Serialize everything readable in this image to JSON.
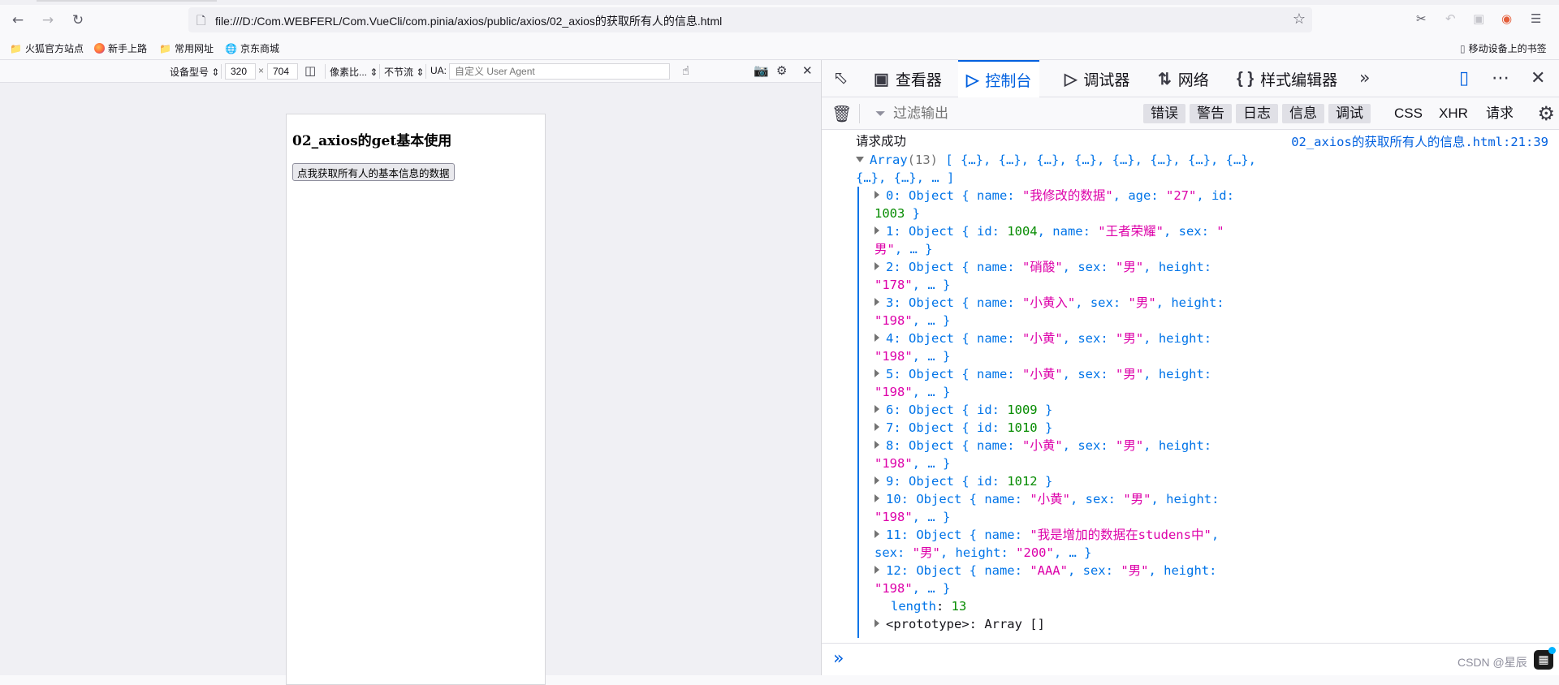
{
  "browser": {
    "url": "file:///D:/Com.WEBFERL/Com.VueCli/com.pinia/axios/public/axios/02_axios的获取所有人的信息.html"
  },
  "bookmarks": {
    "items": [
      "火狐官方站点",
      "新手上路",
      "常用网址",
      "京东商城"
    ],
    "mobile": "移动设备上的书签"
  },
  "rdm": {
    "device_type": "设备型号",
    "width": "320",
    "times": "×",
    "height": "704",
    "dpr": "像素比...",
    "throttle": "不节流",
    "ua_label": "UA:",
    "ua_placeholder": "自定义 User Agent"
  },
  "page": {
    "heading": "02_axios的get基本使用",
    "button": "点我获取所有人的基本信息的数据"
  },
  "devtools": {
    "tabs": [
      "查看器",
      "控制台",
      "调试器",
      "网络",
      "样式编辑器"
    ],
    "selected_tab": "控制台",
    "filter_placeholder": "过滤输出",
    "levels": [
      "错误",
      "警告",
      "日志",
      "信息",
      "调试"
    ],
    "extra_filters": [
      "CSS",
      "XHR",
      "请求"
    ]
  },
  "console": {
    "message": "请求成功",
    "source": "02_axios的获取所有人的信息.html:21:39",
    "array_label": "Array",
    "array_count": "(13)",
    "array_preview_1": "[ {…}, {…}, {…}, {…}, {…}, {…}, {…}, {…},",
    "array_preview_2": "{…}, {…}, … ]",
    "length_key": "length",
    "length_value": "13",
    "prototype": "<prototype>: Array []"
  },
  "watermark": "CSDN @星辰"
}
